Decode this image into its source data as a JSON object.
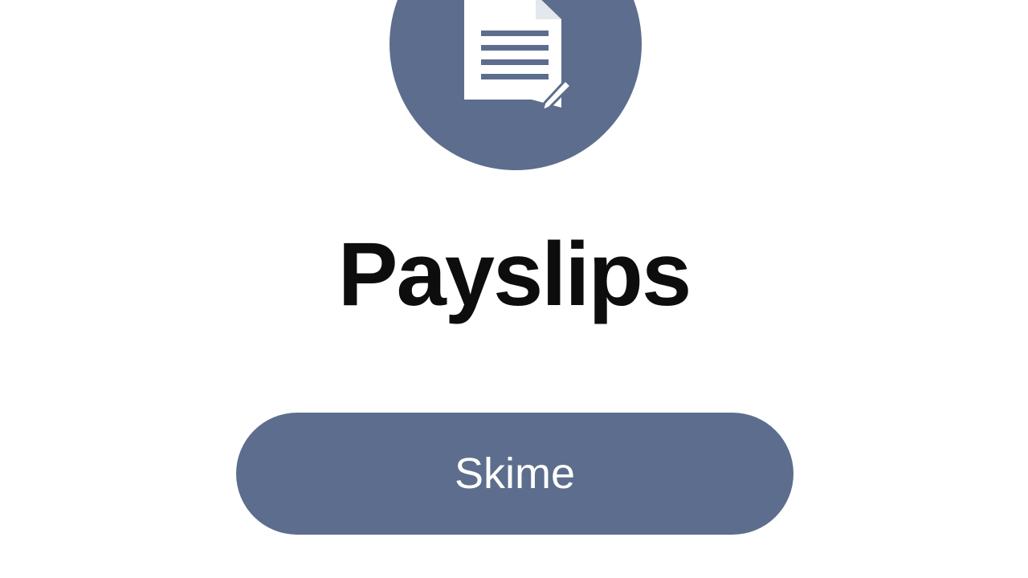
{
  "app": {
    "title": "Payslips",
    "icon": "document-pencil-icon"
  },
  "primary_action": {
    "label": "Skime"
  },
  "colors": {
    "accent": "#5d6d8d",
    "background": "#ffffff",
    "title_text": "#0d0d0d",
    "button_text": "#ffffff"
  }
}
